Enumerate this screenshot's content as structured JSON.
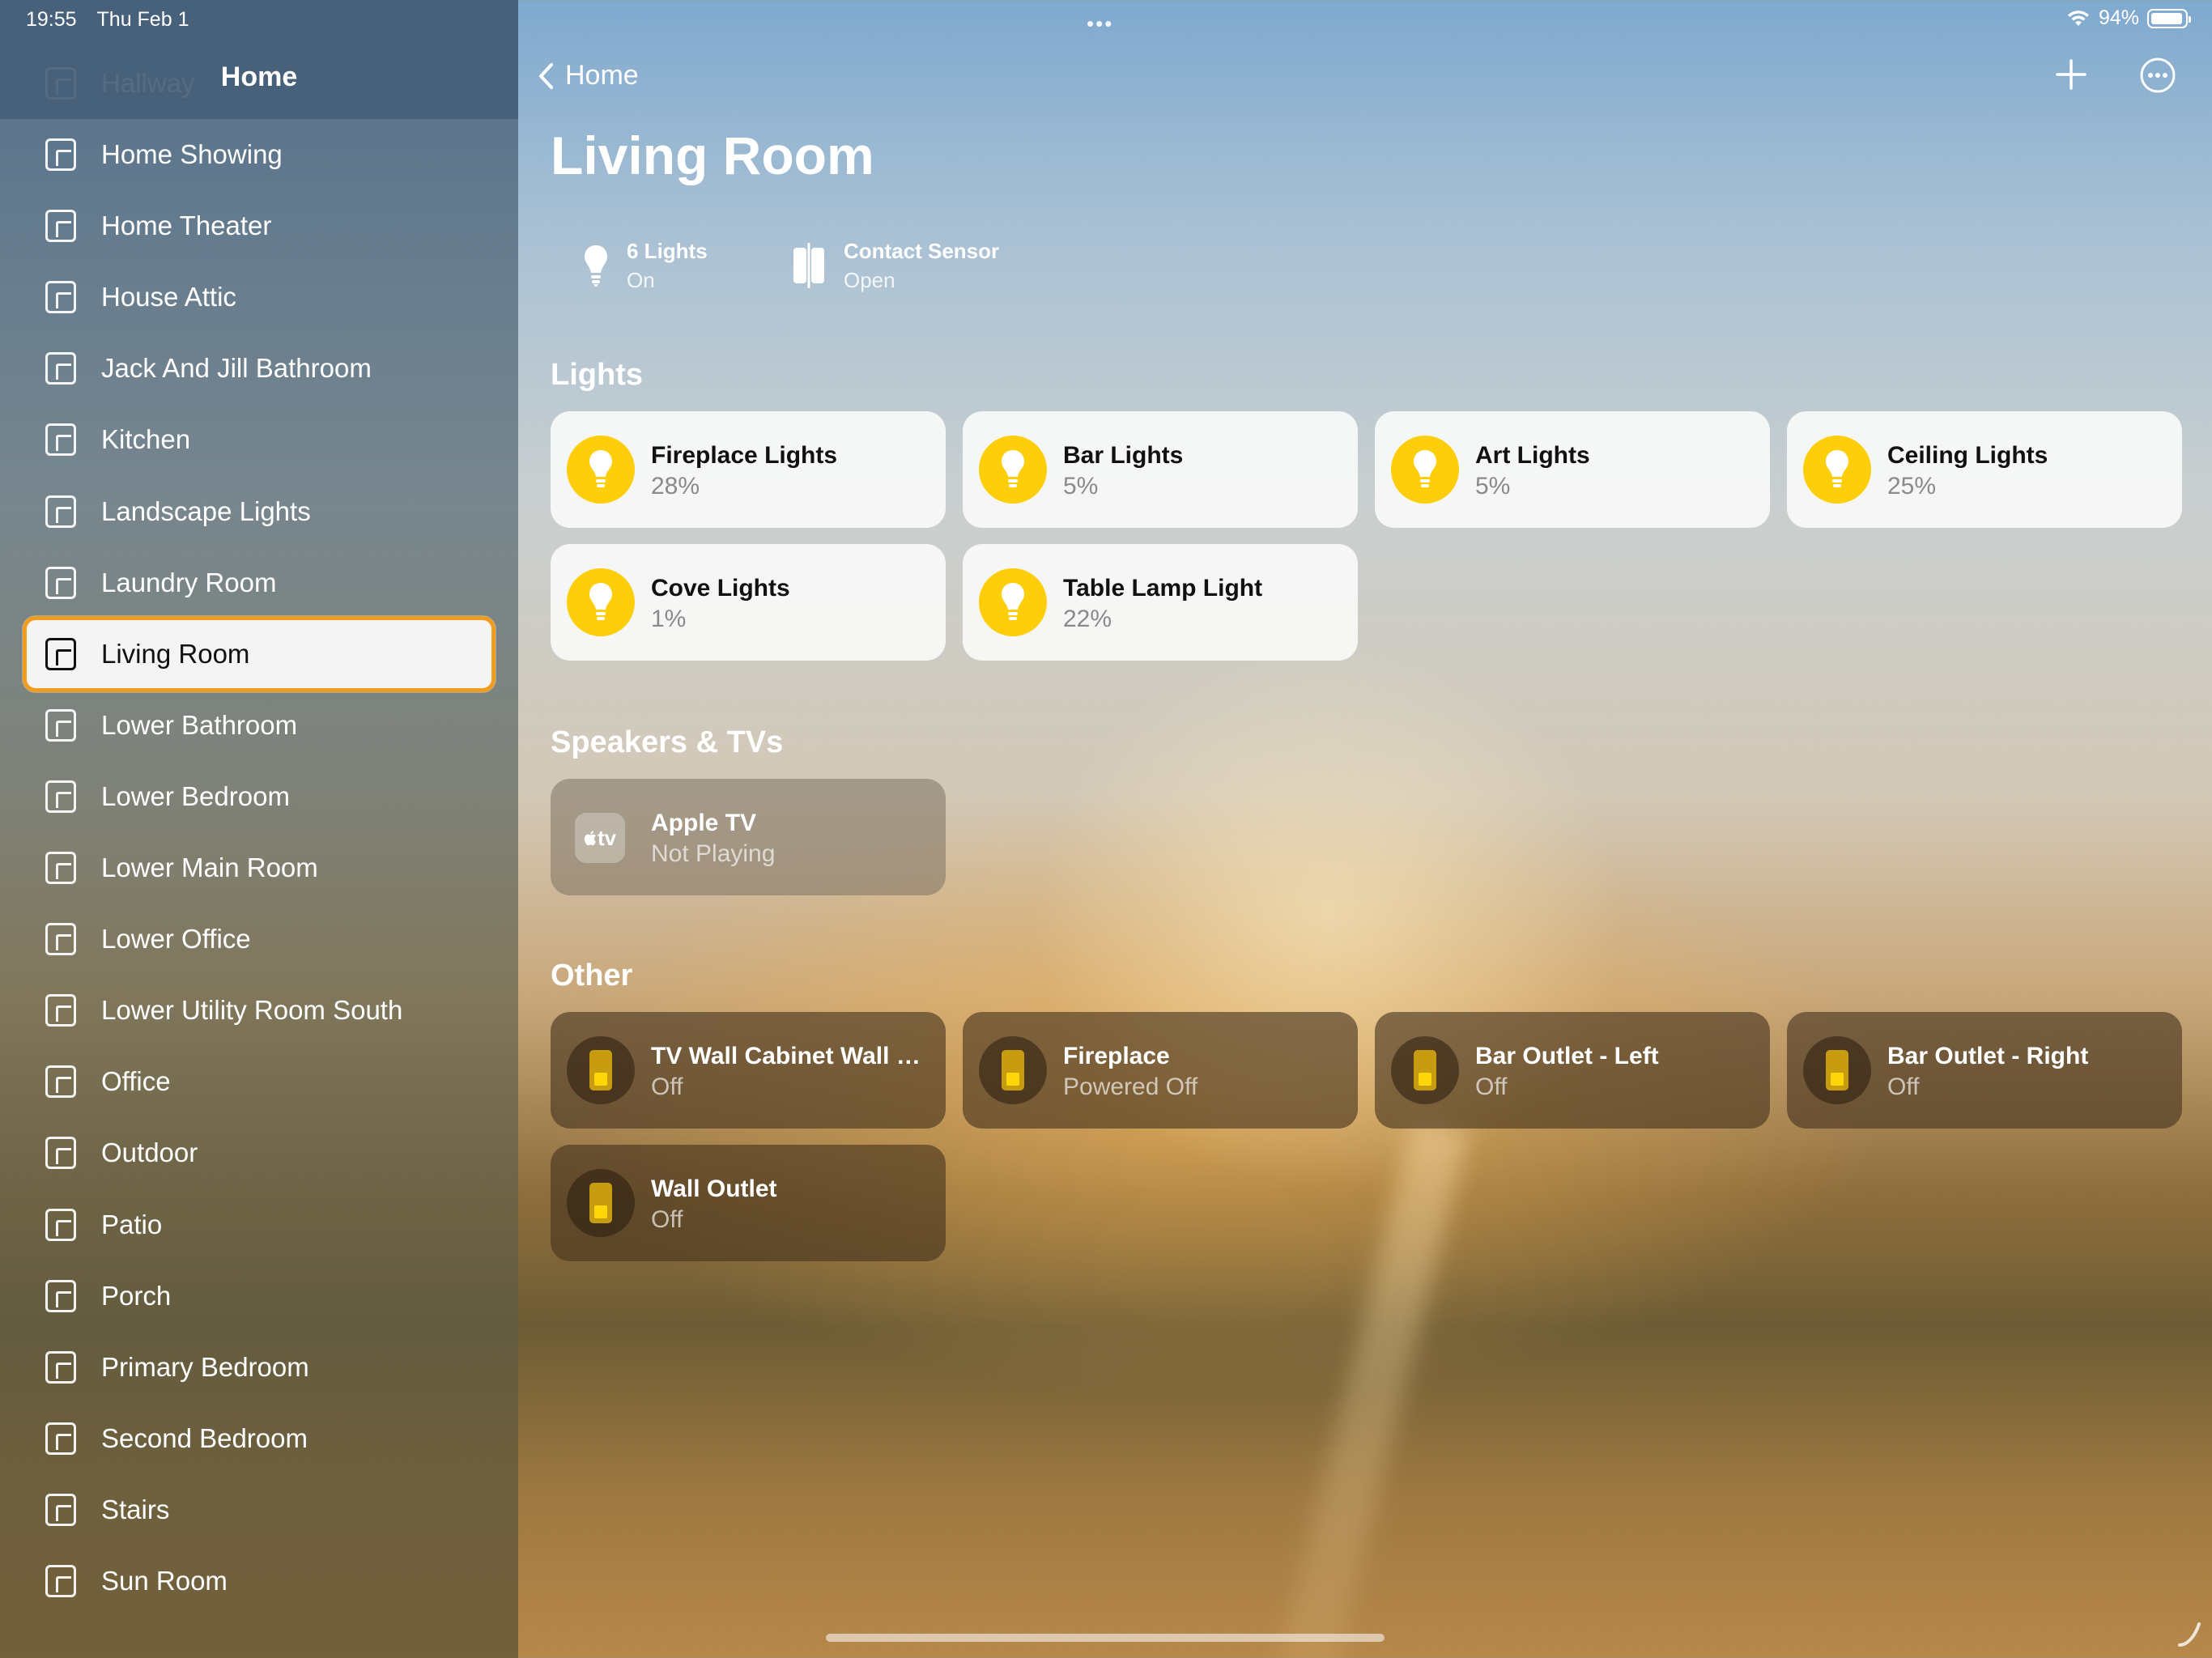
{
  "status_bar": {
    "time": "19:55",
    "date": "Thu Feb 1",
    "battery": "94%",
    "battery_level": 0.94
  },
  "sidebar": {
    "title": "Home",
    "partial_item": "Hallway",
    "selected_index": 8,
    "items": [
      "Home Showing",
      "Home Theater",
      "House Attic",
      "Jack And Jill Bathroom",
      "Kitchen",
      "Landscape Lights",
      "Laundry Room",
      "Living Room",
      "Lower Bathroom",
      "Lower Bedroom",
      "Lower Main Room",
      "Lower Office",
      "Lower Utility Room South",
      "Office",
      "Outdoor",
      "Patio",
      "Porch",
      "Primary Bedroom",
      "Second Bedroom",
      "Stairs",
      "Sun Room"
    ]
  },
  "nav": {
    "back_label": "Home",
    "add_icon": "plus-icon",
    "more_icon": "ellipsis-circle-icon"
  },
  "page": {
    "title": "Living Room"
  },
  "summary": [
    {
      "name": "6 Lights",
      "status": "On",
      "icon": "lightbulb-icon"
    },
    {
      "name": "Contact Sensor",
      "status": "Open",
      "icon": "contact-sensor-icon"
    }
  ],
  "sections": {
    "lights": "Lights",
    "speakers": "Speakers & TVs",
    "other": "Other"
  },
  "lights": [
    {
      "name": "Fireplace Lights",
      "status": "28%"
    },
    {
      "name": "Bar Lights",
      "status": "5%"
    },
    {
      "name": "Art Lights",
      "status": "5%"
    },
    {
      "name": "Ceiling Lights",
      "status": "25%"
    },
    {
      "name": "Cove Lights",
      "status": "1%"
    },
    {
      "name": "Table Lamp Light",
      "status": "22%"
    }
  ],
  "speakers": [
    {
      "name": "Apple TV",
      "status": "Not Playing",
      "icon_text": "tv"
    }
  ],
  "other": [
    {
      "name": "TV Wall Cabinet Wall O...",
      "status": "Off"
    },
    {
      "name": "Fireplace",
      "status": "Powered Off"
    },
    {
      "name": "Bar Outlet - Left",
      "status": "Off"
    },
    {
      "name": "Bar Outlet - Right",
      "status": "Off"
    },
    {
      "name": "Wall Outlet",
      "status": "Off"
    }
  ],
  "colors": {
    "accent_selected": "#f29d1d",
    "light_on": "#fece0a",
    "outlet": "#ffd60a"
  }
}
